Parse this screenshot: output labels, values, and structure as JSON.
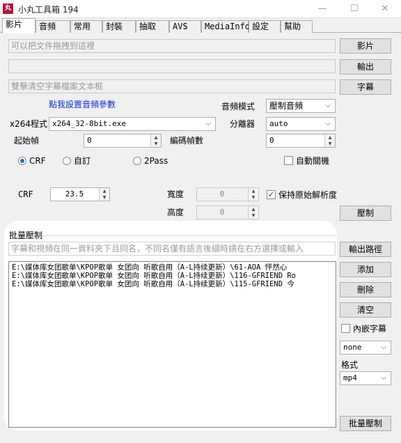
{
  "window": {
    "title": "小丸工具箱 194",
    "icon_glyph": "丸",
    "minimize_glyph": "—",
    "maximize_glyph": "☐",
    "close_glyph": "✕"
  },
  "tabs": [
    "影片",
    "音頻",
    "常用",
    "封裝",
    "抽取",
    "AVS",
    "MediaInfo",
    "設定",
    "幫助"
  ],
  "inputs": {
    "video_file_placeholder": "可以把文件拖拽到這裡",
    "output_file_value": "",
    "subtitle_placeholder": "雙擊清空字幕檔案文本框"
  },
  "buttons": {
    "video": "影片",
    "output": "輸出",
    "subtitle": "字幕",
    "encode": "壓制",
    "output_path": "輸出路徑",
    "add": "添加",
    "delete": "刪除",
    "clear": "清空",
    "batch_encode": "批量壓制"
  },
  "audio": {
    "params_link": "點我設置音頻參數",
    "mode_label": "音頻模式",
    "mode_value": "壓制音頻"
  },
  "x264": {
    "label": "x264程式",
    "value": "x264_32-8bit.exe"
  },
  "splitter": {
    "label": "分離器",
    "value": "auto"
  },
  "frames": {
    "start_label": "起始幀",
    "start_value": "0",
    "encode_label": "編碼幀數",
    "encode_value": "0"
  },
  "rate_mode": {
    "options": [
      "CRF",
      "自訂",
      "2Pass"
    ],
    "selected": "CRF"
  },
  "auto_shutdown_label": "自動關機",
  "crf": {
    "label": "CRF",
    "value": "23.5"
  },
  "size": {
    "width_label": "寬度",
    "width_value": "0",
    "height_label": "高度",
    "height_value": "0",
    "keep_resolution_label": "保持原始解析度"
  },
  "batch": {
    "group_label": "批量壓制",
    "hint_placeholder": "字幕和視頻在同一資料夾下且同名，不同名僅有語言後綴時請在右方選擇或輸入",
    "files": [
      "E:\\媒体库女团歌单\\KPOP歌单  女团向  听歌自用（A-L持续更新）\\61-AOA 怦然心",
      "E:\\媒体库女团歌单\\KPOP歌单  女团向  听歌自用（A-L持续更新）\\116-GFRIEND Ro",
      "E:\\媒体库女团歌单\\KPOP歌单  女团向  听歌自用（A-L持续更新）\\115-GFRIEND 今"
    ],
    "embed_subtitle_label": "內嵌字幕",
    "subtitle_lang_value": "none",
    "format_label": "格式",
    "format_value": "mp4"
  }
}
